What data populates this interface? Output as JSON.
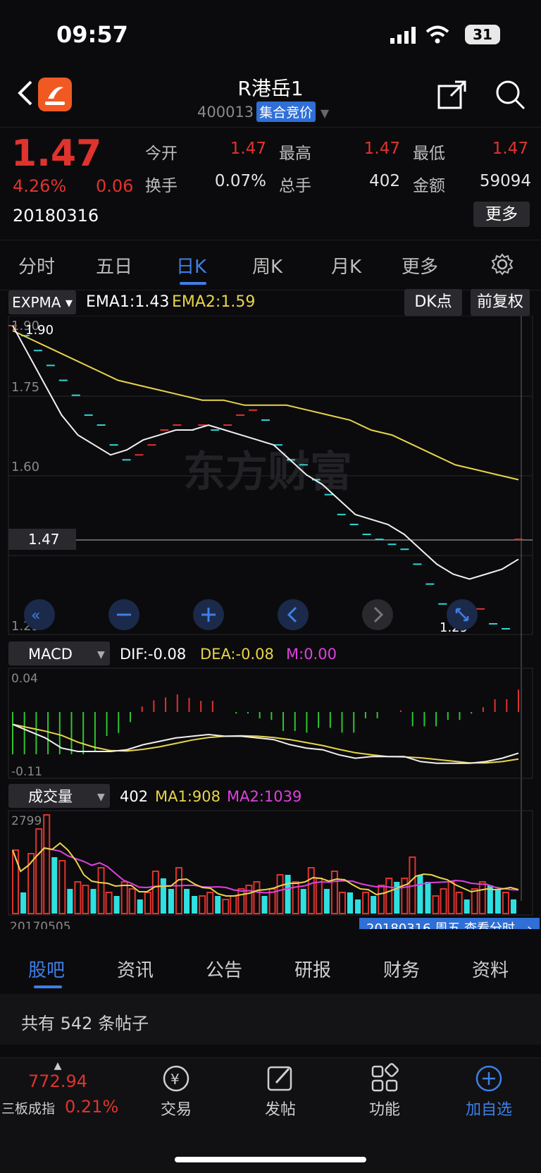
{
  "status": {
    "time": "09:57",
    "battery": "31"
  },
  "header": {
    "title": "R港岳1",
    "code": "400013",
    "badge": "集合竞价"
  },
  "quote": {
    "price": "1.47",
    "change_pct": "4.26%",
    "change": "0.06",
    "date": "20180316",
    "fields": [
      {
        "label": "今开",
        "value": "1.47",
        "red": true
      },
      {
        "label": "最高",
        "value": "1.47",
        "red": true
      },
      {
        "label": "最低",
        "value": "1.47",
        "red": true
      },
      {
        "label": "换手",
        "value": "0.07%",
        "red": false
      },
      {
        "label": "总手",
        "value": "402",
        "red": false
      },
      {
        "label": "金额",
        "value": "59094",
        "red": false
      }
    ],
    "more_label": "更多"
  },
  "tabs": [
    "分时",
    "五日",
    "日K",
    "周K",
    "月K",
    "更多"
  ],
  "active_tab": "日K",
  "kline": {
    "indicator": "EXPMA",
    "ema1": "EMA1:1.43",
    "ema2": "EMA2:1.59",
    "dk_label": "DK点",
    "fq_label": "前复权",
    "y_ticks": [
      "1.90",
      "1.75",
      "1.60",
      "1.47",
      "1.29"
    ],
    "max_label": "1.90",
    "min_label": "1.29",
    "watermark": "东方财富"
  },
  "macd": {
    "name": "MACD",
    "dif": "DIF:-0.08",
    "dea": "DEA:-0.08",
    "m": "M:0.00",
    "top": "0.04",
    "bottom": "-0.11"
  },
  "volume": {
    "name": "成交量",
    "value": "402",
    "ma1": "MA1:908",
    "ma2": "MA2:1039",
    "top": "2799",
    "start_date": "20170505",
    "end_info": "20180316 周五 查看分时"
  },
  "bottom_tabs": [
    "股吧",
    "资讯",
    "公告",
    "研报",
    "财务",
    "资料"
  ],
  "posts": "共有 542 条帖子",
  "footer": {
    "index_value": "772.94",
    "index_name": "三板成指",
    "index_pct": "0.21%",
    "items": [
      "交易",
      "发帖",
      "功能",
      "加自选"
    ]
  },
  "chart_data": {
    "type": "candlestick",
    "note": "daily K-line with EXPMA overlay, MACD and volume panels",
    "start_date": "20170505",
    "end_date": "20180316",
    "ylim": [
      1.29,
      1.9
    ],
    "close": [
      1.9,
      1.88,
      1.85,
      1.82,
      1.79,
      1.76,
      1.72,
      1.7,
      1.66,
      1.63,
      1.64,
      1.66,
      1.69,
      1.7,
      1.69,
      1.7,
      1.69,
      1.7,
      1.72,
      1.73,
      1.71,
      1.66,
      1.63,
      1.62,
      1.59,
      1.56,
      1.52,
      1.5,
      1.48,
      1.47,
      1.46,
      1.45,
      1.42,
      1.38,
      1.34,
      1.33,
      1.32,
      1.33,
      1.3,
      1.29,
      1.47
    ],
    "ema1": [
      1.9,
      1.84,
      1.78,
      1.72,
      1.68,
      1.66,
      1.64,
      1.65,
      1.67,
      1.68,
      1.69,
      1.69,
      1.7,
      1.69,
      1.68,
      1.67,
      1.66,
      1.63,
      1.6,
      1.58,
      1.55,
      1.52,
      1.51,
      1.5,
      1.48,
      1.45,
      1.42,
      1.4,
      1.39,
      1.4,
      1.41,
      1.43
    ],
    "ema2": [
      1.89,
      1.87,
      1.85,
      1.83,
      1.81,
      1.79,
      1.78,
      1.77,
      1.76,
      1.75,
      1.75,
      1.74,
      1.74,
      1.74,
      1.73,
      1.72,
      1.71,
      1.69,
      1.68,
      1.66,
      1.64,
      1.62,
      1.61,
      1.6,
      1.59
    ],
    "volume": [
      1800,
      600,
      1700,
      2400,
      2799,
      1600,
      1500,
      700,
      900,
      800,
      700,
      1300,
      600,
      500,
      900,
      700,
      400,
      600,
      1200,
      1000,
      700,
      1300,
      700,
      500,
      500,
      600,
      500,
      400,
      500,
      700,
      800,
      900,
      500,
      700,
      1100,
      1100,
      900,
      700,
      1300,
      1000,
      700,
      1200,
      600,
      600,
      400,
      600,
      500,
      800,
      1000,
      900,
      1000,
      1600,
      1100,
      900,
      500,
      700,
      900,
      600,
      400,
      700,
      900,
      800,
      700,
      600,
      402
    ],
    "vol_ma1": [
      908
    ],
    "vol_ma2": [
      1039
    ],
    "macd": {
      "dif": -0.08,
      "dea": -0.08,
      "m": 0.0,
      "range": [
        -0.11,
        0.04
      ]
    }
  }
}
